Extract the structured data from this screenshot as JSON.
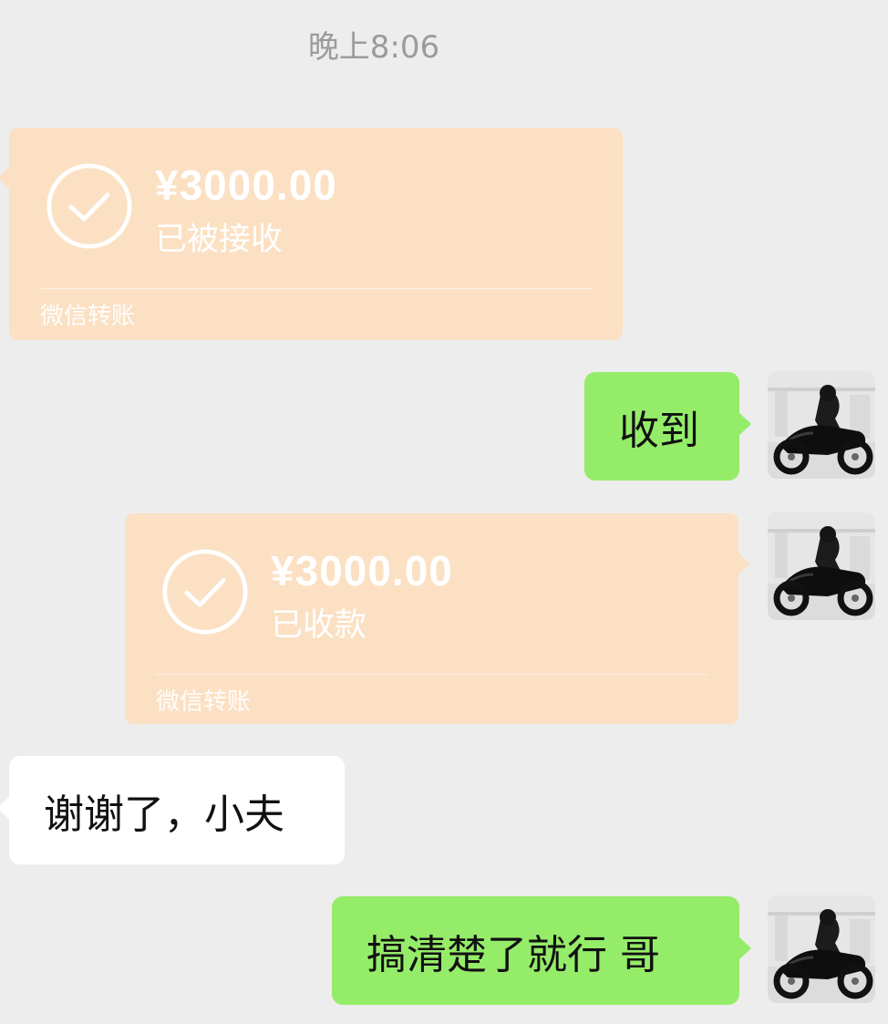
{
  "chat": {
    "timestamp": "晚上8:06",
    "messages": [
      {
        "type": "transfer",
        "side": "left",
        "amount": "¥3000.00",
        "status": "已被接收",
        "source": "微信转账"
      },
      {
        "type": "text",
        "side": "right",
        "text": "收到"
      },
      {
        "type": "transfer",
        "side": "right",
        "amount": "¥3000.00",
        "status": "已收款",
        "source": "微信转账"
      },
      {
        "type": "text",
        "side": "left",
        "text": "谢谢了，小夫"
      },
      {
        "type": "text",
        "side": "right",
        "text": "搞清楚了就行 哥"
      }
    ]
  },
  "icons": {
    "check": "check-circle-icon",
    "avatar": "motorcycle-rider-avatar"
  },
  "colors": {
    "background": "#ededed",
    "transfer_card": "#fbe0c3",
    "self_bubble": "#95ec69",
    "other_bubble": "#ffffff",
    "timestamp_text": "#9b9b9b"
  }
}
